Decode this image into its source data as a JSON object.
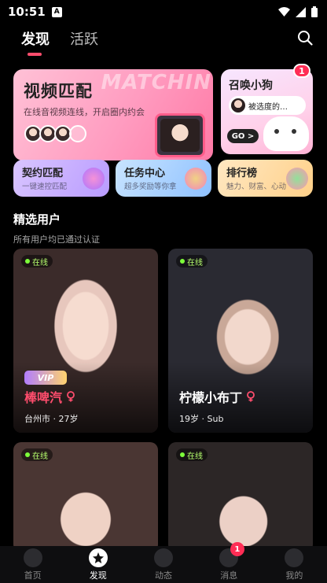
{
  "status_bar": {
    "time": "10:51",
    "app_icon": "A"
  },
  "top_tabs": {
    "discover": "发现",
    "active": "活跃"
  },
  "banners": {
    "video_match": {
      "title": "视频匹配",
      "subtitle": "在线音视频连线，开启圈内约会",
      "watermark": "MATCHIN"
    },
    "summon_dog": {
      "title": "召唤小狗",
      "bubble_text": "被选度的…",
      "go_label": "GO >",
      "badge": "1"
    },
    "contract_match": {
      "title": "契约匹配",
      "subtitle": "一键速控匹配"
    },
    "task_center": {
      "title": "任务中心",
      "subtitle": "超多奖励等你拿"
    },
    "ranking": {
      "title": "排行榜",
      "subtitle": "魅力、财富、心动"
    }
  },
  "section": {
    "title": "精选用户",
    "subtitle": "所有用户均已通过认证"
  },
  "users": [
    {
      "status": "在线",
      "vip": "VIP",
      "name": "棒啤汽",
      "meta": "台州市 · 27岁"
    },
    {
      "status": "在线",
      "name": "柠檬小布丁",
      "meta": "19岁 · Sub"
    },
    {
      "status": "在线"
    },
    {
      "status": "在线"
    }
  ],
  "bottom_nav": [
    {
      "label": "首页"
    },
    {
      "label": "发现"
    },
    {
      "label": "动态"
    },
    {
      "label": "消息",
      "badge": "1"
    },
    {
      "label": "我的"
    }
  ],
  "colors": {
    "accent": "#ff4d6d",
    "online": "#7dff3a",
    "badge": "#ff2d55"
  }
}
